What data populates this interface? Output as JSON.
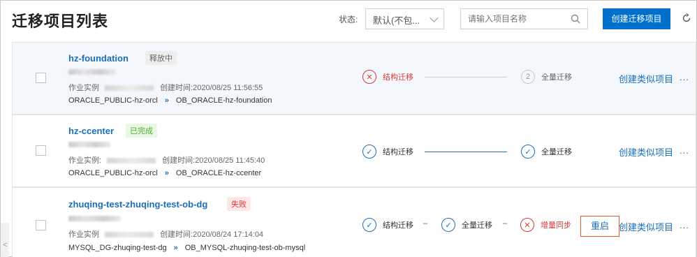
{
  "header": {
    "title": "迁移项目列表",
    "status_label": "状态:",
    "status_value": "默认(不包...",
    "search_placeholder": "请输入项目名称",
    "create_button": "创建迁移项目"
  },
  "colors": {
    "accent": "#0070cc",
    "link": "#1a6fb8",
    "error": "#d9383a",
    "success": "#4caf2a"
  },
  "projects": [
    {
      "name": "hz-foundation",
      "badge": "释放中",
      "instance_label": "作业实例",
      "created_label": "创建时间:",
      "created_time": "2020/08/25 11:56:55",
      "source": "ORACLE_PUBLIC-hz-orcl",
      "target": "OB_ORACLE-hz-foundation",
      "steps": [
        {
          "label": "结构迁移",
          "state": "error",
          "glyph": "✕"
        },
        {
          "label": "全量迁移",
          "state": "pending",
          "glyph": "2"
        }
      ],
      "action": "创建类似项目",
      "more": "..."
    },
    {
      "name": "hz-ccenter",
      "badge": "已完成",
      "instance_label": "作业实例:",
      "created_label": "创建时间:",
      "created_time": "2020/08/25 11:45:40",
      "source": "ORACLE_PUBLIC-hz-orcl",
      "target": "OB_ORACLE-hz-ccenter",
      "steps": [
        {
          "label": "结构迁移",
          "state": "done",
          "glyph": "✓"
        },
        {
          "label": "全量迁移",
          "state": "done",
          "glyph": "✓"
        }
      ],
      "action": "创建类似项目",
      "more": "..."
    },
    {
      "name": "zhuqing-test-zhuqing-test-ob-dg",
      "badge": "失败",
      "instance_label": "作业实例",
      "created_label": "创建时间:",
      "created_time": "2020/08/24 17:14:04",
      "source": "MYSQL_DG-zhuqing-test-dg",
      "target": "OB_MYSQL-zhuqing-test-ob-mysql",
      "steps": [
        {
          "label": "结构迁移",
          "state": "done",
          "glyph": "✓"
        },
        {
          "label": "全量迁移",
          "state": "done",
          "glyph": "✓"
        },
        {
          "label": "增量同步",
          "state": "error",
          "glyph": "✕"
        }
      ],
      "restart": "重启",
      "action": "创建类似项目",
      "more": "..."
    }
  ],
  "icons": {
    "search": "search-icon",
    "refresh": "refresh-icon",
    "route": "double-chevron-right-icon"
  },
  "scroll_glyph": "<"
}
